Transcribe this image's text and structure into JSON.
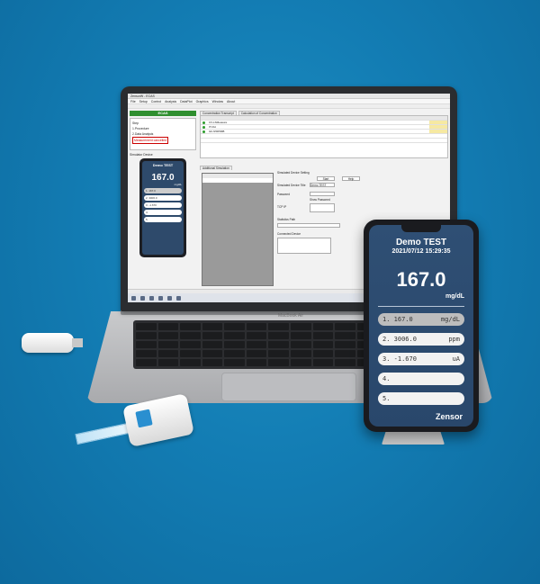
{
  "laptop": {
    "brand": "MacBook Air",
    "window_title": "ZensorW - ECAS",
    "menu": [
      "File",
      "Setup",
      "Control",
      "Analysis",
      "DataPlot",
      "Graphics",
      "Window",
      "About"
    ],
    "app_header": "ECAS",
    "steps_label": "Step",
    "steps": [
      "1.Procedure",
      "2.Data Analysis"
    ],
    "step_warning": "Measurement cancelled",
    "simulator_label": "Simulator Device",
    "mini_phone": {
      "title": "Demo TEST",
      "value": "167.0",
      "unit": "mg/dL",
      "rows": [
        "1. 167.0",
        "2. 3006.0",
        "3. -1.670",
        "4.",
        "5."
      ]
    },
    "tabs": [
      "Concentration Transcript",
      "Calculation of Concentration"
    ],
    "grid_rows": [
      "CV-LSMeasure",
      "IT-DH",
      "GF-N5D5MB"
    ],
    "lower_tab": "Additional Simulation",
    "form": {
      "heading": "Simulated Device Setting",
      "start_button": "Start",
      "help_button": "Help",
      "device_title_label": "Simulated Device Title",
      "device_title_value": "Demo TEST",
      "password_label": "Password",
      "show_password": "Show Password",
      "tcpip_label": "TCP IP",
      "history_label": "Statistics Path",
      "connected_label": "Connected Device"
    }
  },
  "phone": {
    "title": "Demo TEST",
    "timestamp": "2021/07/12 15:29:35",
    "value": "167.0",
    "unit": "mg/dL",
    "rows": [
      {
        "label": "1. 167.0",
        "unit": "mg/dL",
        "selected": true
      },
      {
        "label": "2. 3006.0",
        "unit": "ppm",
        "selected": false
      },
      {
        "label": "3. -1.670",
        "unit": "uA",
        "selected": false
      },
      {
        "label": "4.",
        "unit": "",
        "selected": false
      },
      {
        "label": "5.",
        "unit": "",
        "selected": false
      }
    ],
    "logo": "Zensor"
  },
  "colors": {
    "background": "#137db4",
    "phone_screen": "#2f4f74",
    "ecas_green": "#2f8f2f",
    "highlight": "#f6e9a2"
  }
}
